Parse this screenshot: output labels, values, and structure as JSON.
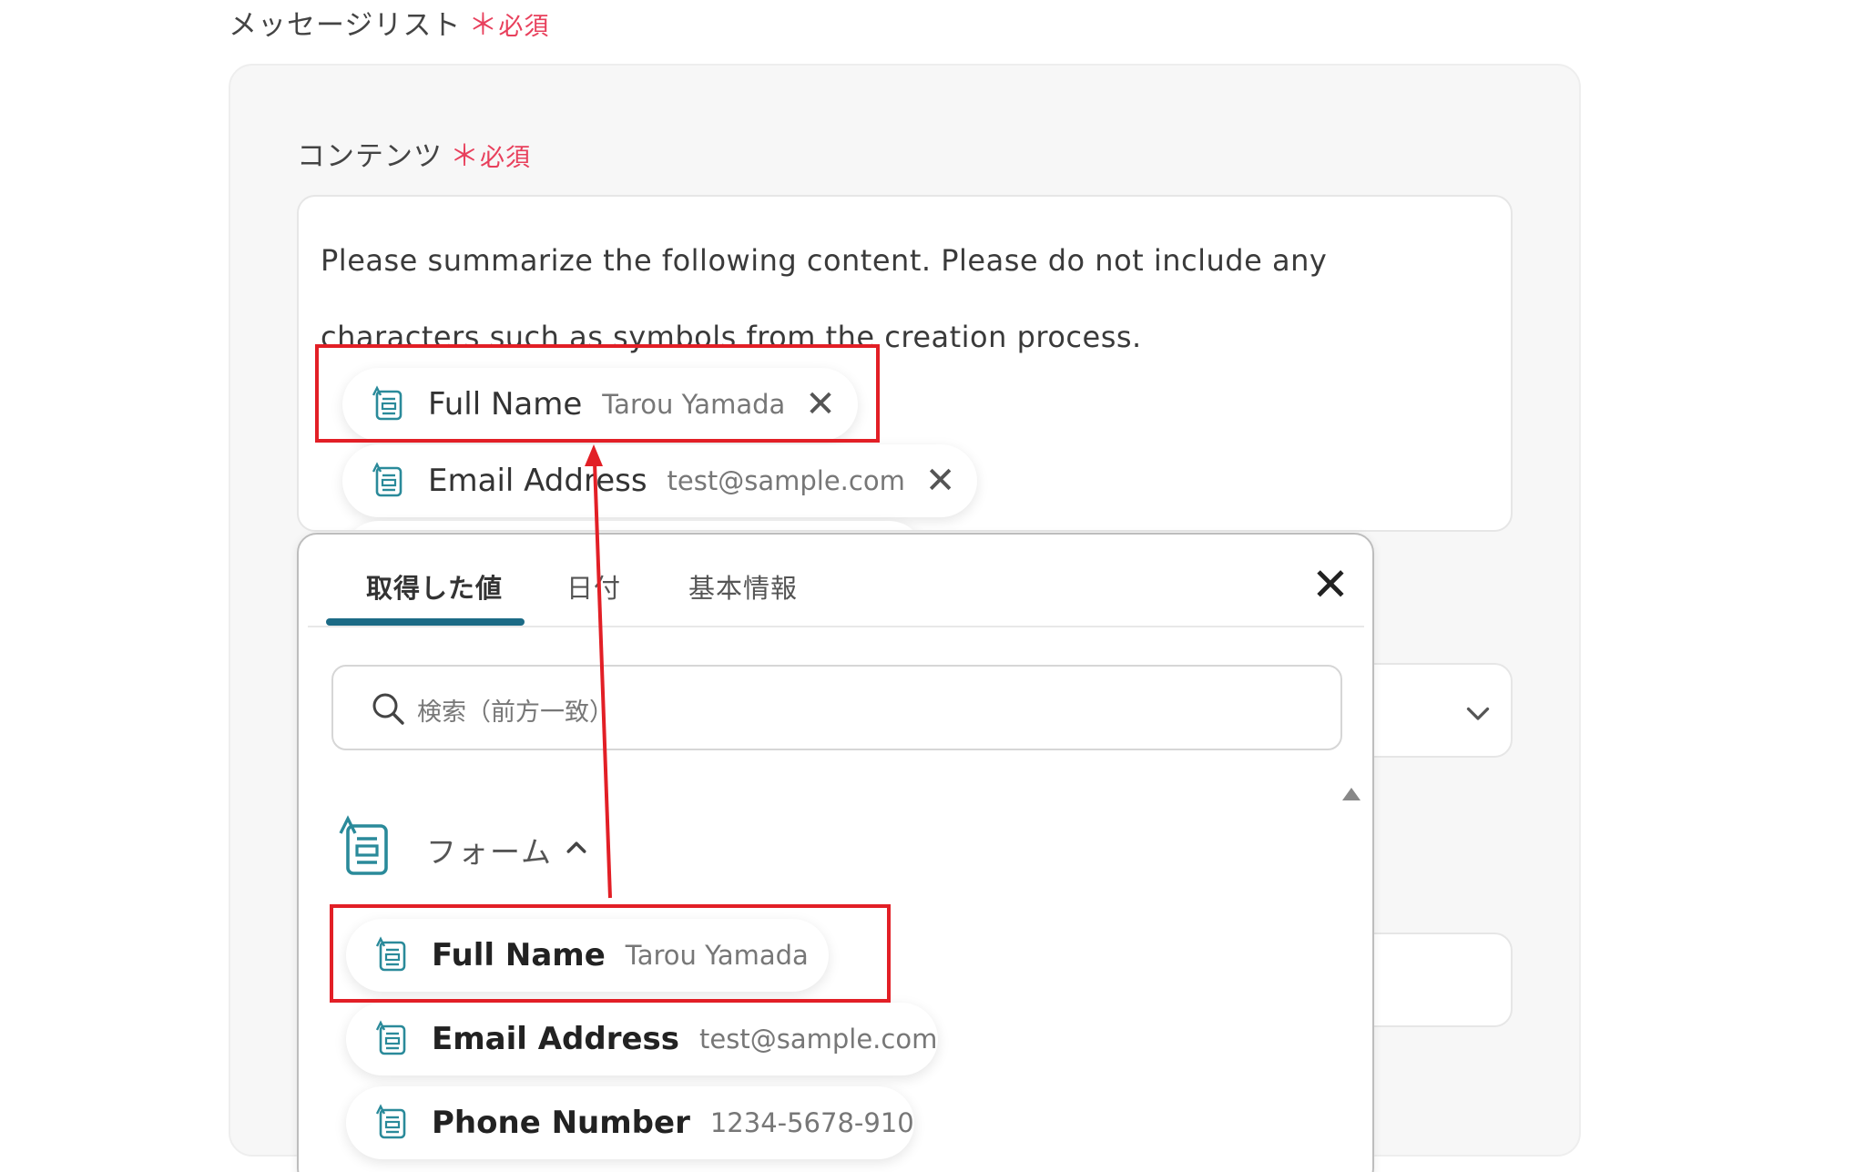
{
  "message_list": {
    "label": "メッセージリスト",
    "required": "必須",
    "required_mark": "＊"
  },
  "contents": {
    "label": "コンテンツ",
    "required": "必須",
    "required_mark": "＊",
    "text": "Please summarize the following content. Please do not include any characters such as symbols from the creation process.",
    "chips": [
      {
        "label": "Full Name",
        "value": "Tarou Yamada",
        "close": "✕"
      },
      {
        "label": "Email Address",
        "value": "test@sample.com",
        "close": "✕"
      }
    ]
  },
  "popup": {
    "tabs": [
      {
        "label": "取得した値",
        "active": true
      },
      {
        "label": "日付",
        "active": false
      },
      {
        "label": "基本情報",
        "active": false
      }
    ],
    "close": "✕",
    "search_placeholder": "検索（前方一致）",
    "group": {
      "label": "フォーム",
      "icon": "form-icon",
      "expanded": true
    },
    "items": [
      {
        "label": "Full Name",
        "value": "Tarou Yamada"
      },
      {
        "label": "Email Address",
        "value": "test@sample.com"
      },
      {
        "label": "Phone Number",
        "value": "1234-5678-910"
      }
    ]
  },
  "colors": {
    "accent": "#1c6b86",
    "required": "#e8405c",
    "annotation": "#e21f26",
    "icon": "#2a8a9a"
  }
}
